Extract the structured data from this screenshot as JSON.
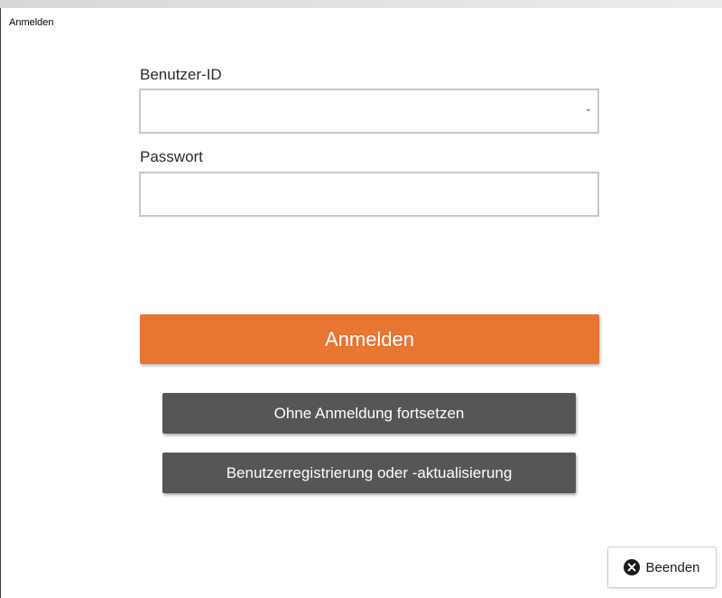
{
  "window": {
    "title": "Anmelden"
  },
  "form": {
    "user_id_label": "Benutzer-ID",
    "user_id_value": "",
    "password_label": "Passwort",
    "password_value": ""
  },
  "buttons": {
    "login_label": "Anmelden",
    "guest_label": "Ohne Anmeldung fortsetzen",
    "register_label": "Benutzerregistrierung oder -aktualisierung",
    "exit_label": "Beenden"
  },
  "icons": {
    "dropdown": "chevron-down-icon",
    "exit": "close-circle-icon"
  },
  "colors": {
    "primary": "#e87532",
    "secondary": "#575555"
  }
}
